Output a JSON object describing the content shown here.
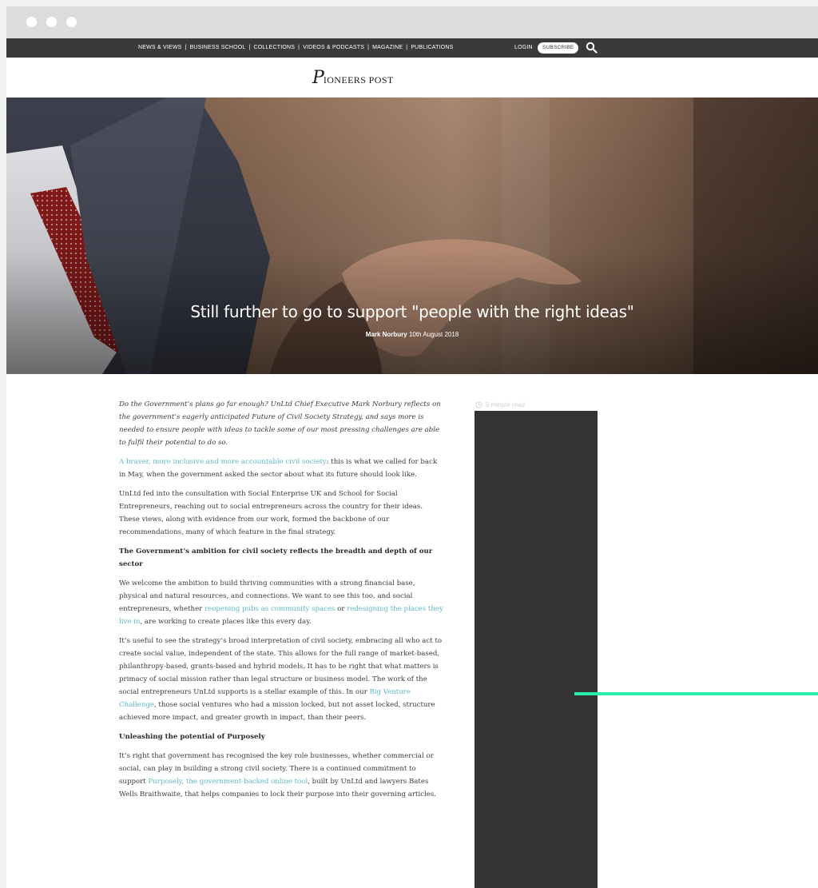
{
  "nav": {
    "links": [
      "NEWS & VIEWS",
      "BUSINESS SCHOOL",
      "COLLECTIONS",
      "VIDEOS & PODCASTS",
      "MAGAZINE",
      "PUBLICATIONS"
    ],
    "separator": "|",
    "login": "LOGIN",
    "subscribe": "SUBSCRIBE",
    "search_icon": "search-icon"
  },
  "brand": {
    "logo_initial": "P",
    "logo_rest": "IONEERS POST"
  },
  "hero": {
    "title": "Still further to go to support \"people with the right ideas\"",
    "author": "Mark Norbury",
    "date": "10th August 2018"
  },
  "sidebar": {
    "read_time": "5 minute read",
    "clock_icon": "clock-icon"
  },
  "article": {
    "intro": "Do the Government’s plans go far enough? UnLtd Chief Executive Mark Norbury reflects on the government’s eagerly anticipated Future of Civil Society Strategy, and says more is needed to ensure people with ideas to tackle some of our most pressing challenges are able to fulfil their potential to do so.",
    "p1_link": "A braver, more inclusive and more accountable civil society",
    "p1_text": ": this is what we called for back in May, when the government asked the sector about what its future should look like.",
    "p2": "UnLtd fed into the consultation with Social Enterprise UK and School for Social Entrepreneurs, reaching out to social entrepreneurs across the country for their ideas. These views, along with evidence from our work, formed the backbone of our recommendations, many of which feature in the final strategy.",
    "h1": "The Government’s ambition for civil society reflects the breadth and depth of our sector",
    "p3_a": "We welcome the ambition to build thriving communities with a strong financial base, physical and natural resources, and connections. We want to see this too, and social entrepreneurs, whether ",
    "p3_link1": "reopening pubs as community spaces",
    "p3_b": " or ",
    "p3_link2": "redesigning the places they live in",
    "p3_c": ", are working to create places like this every day.",
    "p4_a": "It’s useful to see the strategy’s broad interpretation of civil society, embracing all who act to create social value, independent of the state. This allows for the full range of market-based, philanthropy-based, grants-based and hybrid models. It has to be right that what matters is primacy of social mission rather than legal structure or business model. The work of the social entrepreneurs UnLtd supports is a stellar example of this. In our ",
    "p4_link": "Big Venture Challenge",
    "p4_b": ", those social ventures who had a mission locked, but not asset locked, structure achieved more impact, and greater growth in impact, than their peers.",
    "h2": "Unleashing the potential of Purposely",
    "p5_a": "It’s right that government has recognised the key role businesses, whether commercial or social, can play in building a strong civil society. There is a continued commitment to support ",
    "p5_link": "Purposely, the government-backed online tool",
    "p5_b": ", built by UnLtd and lawyers Bates Wells Braithwaite, that helps companies to lock their purpose into their governing articles."
  },
  "colors": {
    "accent_link": "#5fb7c9",
    "nav_bg": "#3a3a3a",
    "green_line": "#21f0a6",
    "sidebar_block": "#333333"
  }
}
